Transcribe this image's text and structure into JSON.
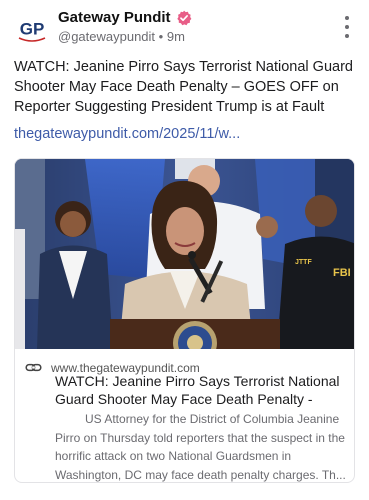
{
  "post": {
    "account": {
      "name": "Gateway Pundit",
      "handle": "@gatewaypundit",
      "separator": "•",
      "time": "9m",
      "avatar_initials": "GP",
      "verified_color": "#e85d87"
    },
    "text": "WATCH: Jeanine Pirro Says Terrorist National Guard Shooter May Face Death Penalty – GOES OFF on Reporter Suggesting President Trump is at Fault",
    "link_text": "thegatewaypundit.com/2025/11/w...",
    "link_color": "#3e5ba8",
    "card": {
      "domain": "www.thegatewaypundit.com",
      "title": "WATCH: Jeanine Pirro Says Terrorist National Guard Shooter May Face Death Penalty - GOE...",
      "description": "US Attorney for the District of Columbia Jeanine Pirro on Thursday told reporters that the suspect in the horrific attack on two National Guardsmen in Washington, DC may face death penalty charges.  Th...",
      "image_badges": {
        "jttf": "JTTF",
        "fbi": "FBI"
      }
    }
  }
}
